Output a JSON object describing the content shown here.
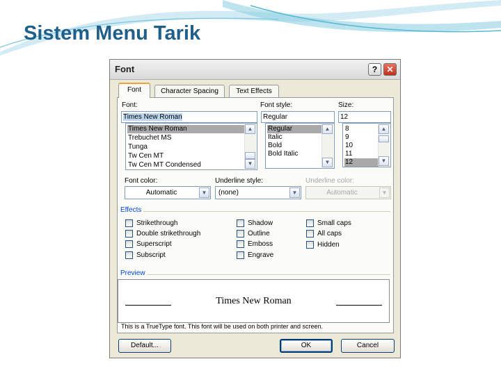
{
  "slide": {
    "title": "Sistem Menu Tarik"
  },
  "dialog": {
    "title": "Font",
    "help_glyph": "?",
    "close_glyph": "✕",
    "tabs": [
      {
        "label": "Font",
        "active": true
      },
      {
        "label": "Character Spacing",
        "active": false
      },
      {
        "label": "Text Effects",
        "active": false
      }
    ],
    "font": {
      "label": "Font:",
      "value": "Times New Roman",
      "items": [
        "Times New Roman",
        "Trebuchet MS",
        "Tunga",
        "Tw Cen MT",
        "Tw Cen MT Condensed"
      ],
      "selected": "Times New Roman"
    },
    "font_style": {
      "label": "Font style:",
      "value": "Regular",
      "items": [
        "Regular",
        "Italic",
        "Bold",
        "Bold Italic"
      ],
      "selected": "Regular"
    },
    "size": {
      "label": "Size:",
      "value": "12",
      "items": [
        "8",
        "9",
        "10",
        "11",
        "12"
      ],
      "selected": "12"
    },
    "font_color": {
      "label": "Font color:",
      "value": "Automatic"
    },
    "underline_style": {
      "label": "Underline style:",
      "value": "(none)"
    },
    "underline_color": {
      "label": "Underline color:",
      "value": "Automatic",
      "enabled": false
    },
    "effects": {
      "label": "Effects",
      "col1": [
        "Strikethrough",
        "Double strikethrough",
        "Superscript",
        "Subscript"
      ],
      "col2": [
        "Shadow",
        "Outline",
        "Emboss",
        "Engrave"
      ],
      "col3": [
        "Small caps",
        "All caps",
        "Hidden"
      ]
    },
    "preview": {
      "label": "Preview",
      "sample": "Times New Roman",
      "note": "This is a TrueType font. This font will be used on both printer and screen."
    },
    "buttons": {
      "default": "Default...",
      "ok": "OK",
      "cancel": "Cancel"
    }
  },
  "icons": {
    "scroll_up": "▲",
    "scroll_down": "▼",
    "dropdown": "▼"
  }
}
